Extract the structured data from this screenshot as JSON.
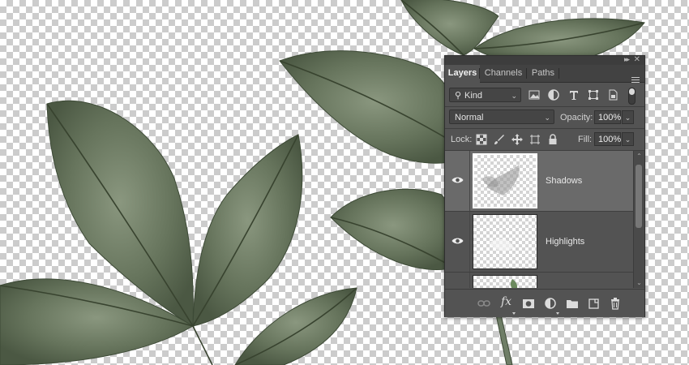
{
  "window_controls": {
    "collapse_icon": "double-chevron-right-icon",
    "close_icon": "close-icon"
  },
  "panel": {
    "tabs": [
      {
        "label": "Layers",
        "active": true
      },
      {
        "label": "Channels",
        "active": false
      },
      {
        "label": "Paths",
        "active": false
      }
    ],
    "menu_icon": "hamburger-menu-icon"
  },
  "filter": {
    "kind_label": "Kind",
    "filter_icons": [
      "pixel-layer-filter-icon",
      "adjustment-layer-filter-icon",
      "type-layer-filter-icon",
      "shape-layer-filter-icon",
      "smart-object-filter-icon"
    ],
    "toggle_icon": "filter-toggle-icon"
  },
  "blending": {
    "mode": "Normal",
    "opacity_label": "Opacity:",
    "opacity_value": "100%"
  },
  "lock": {
    "label": "Lock:",
    "icons": [
      "lock-transparent-pixels-icon",
      "lock-image-pixels-icon",
      "lock-position-icon",
      "lock-artboard-icon",
      "lock-all-icon"
    ],
    "fill_label": "Fill:",
    "fill_value": "100%"
  },
  "layers": [
    {
      "name": "Shadows",
      "visible": true,
      "selected": true
    },
    {
      "name": "Highlights",
      "visible": true,
      "selected": false
    },
    {
      "name": "",
      "visible": true,
      "selected": false
    }
  ],
  "bottom_icons": [
    "link-layers-icon",
    "fx-icon",
    "add-mask-icon",
    "new-adjustment-layer-icon",
    "new-group-folder-icon",
    "new-layer-icon",
    "trash-icon"
  ],
  "colors": {
    "panel_bg": "#535353",
    "selected_layer": "#6a6a6a",
    "leaf_green": "#6f7e67"
  }
}
